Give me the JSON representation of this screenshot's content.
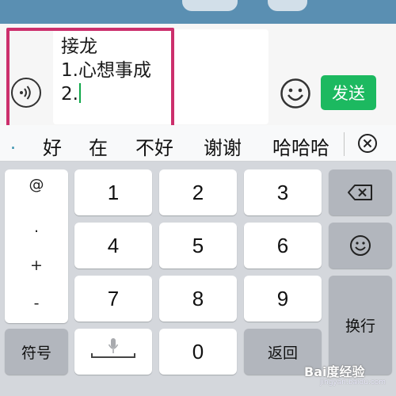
{
  "input": {
    "lines": [
      "接龙",
      "1.心想事成",
      "2."
    ]
  },
  "send_label": "发送",
  "suggestions": {
    "dot": ".",
    "words": [
      "好",
      "在",
      "不好",
      "谢谢",
      "哈哈哈"
    ]
  },
  "keyboard": {
    "symbols": [
      "@",
      ".",
      "+",
      "-"
    ],
    "digits": [
      "1",
      "2",
      "3",
      "4",
      "5",
      "6",
      "7",
      "8",
      "9",
      "0"
    ],
    "symbol_key": "符号",
    "return_key": "返回",
    "newline_key": "换行"
  },
  "watermark": {
    "text": "Bai度经验",
    "sub": "jingyan.baidu.com"
  },
  "colors": {
    "accent_green": "#1cb960",
    "highlight": "#cc2f6c"
  },
  "icons": [
    "voice-icon",
    "emoji-icon",
    "clear-icon",
    "backspace-icon",
    "smiley-icon",
    "mic-icon"
  ]
}
